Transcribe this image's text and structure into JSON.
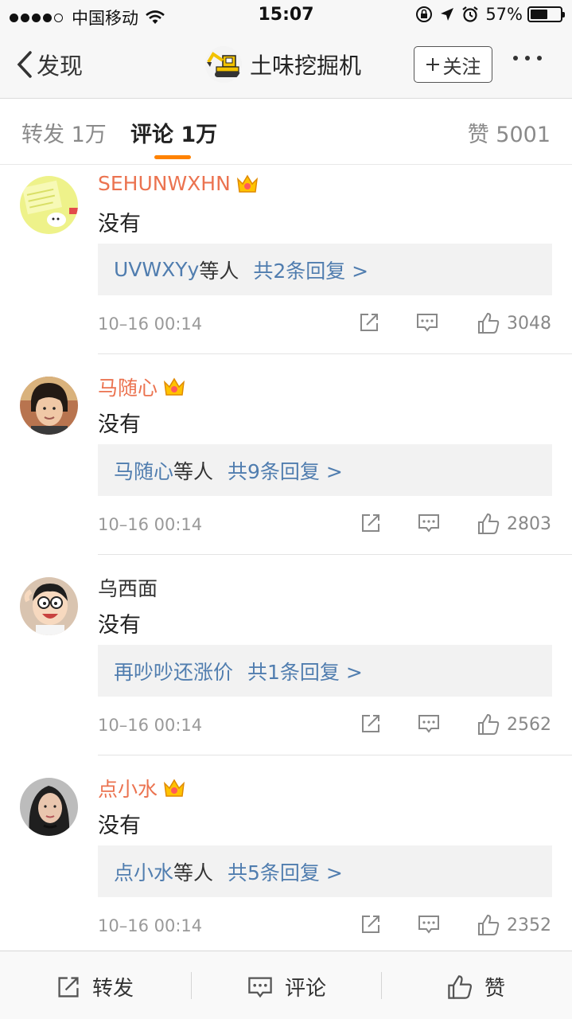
{
  "status_bar": {
    "carrier": "中国移动",
    "time": "15:07",
    "battery_text": "57%",
    "battery_level": 0.57
  },
  "nav": {
    "back_label": "发现",
    "title": "土味挖掘机",
    "follow_label": "关注"
  },
  "tabs": {
    "repost": "转发 1万",
    "comments": "评论 1万",
    "likes": "赞 5001"
  },
  "comments": [
    {
      "name": "SEHUNWXHN",
      "vip": true,
      "text": "没有",
      "reply_users": "UVWXYy",
      "reply_suffix": "等人",
      "reply_count": "共2条回复 >",
      "time": "10–16 00:14",
      "likes": "3048"
    },
    {
      "name": "马随心",
      "vip": true,
      "text": "没有",
      "reply_users": "马随心",
      "reply_suffix": "等人",
      "reply_count": "共9条回复 >",
      "time": "10–16 00:14",
      "likes": "2803"
    },
    {
      "name": "乌西面",
      "vip": false,
      "text": "没有",
      "reply_users": "再吵吵还涨价",
      "reply_suffix": "",
      "reply_count": "共1条回复 >",
      "time": "10–16 00:14",
      "likes": "2562"
    },
    {
      "name": "点小水",
      "vip": true,
      "text": "没有",
      "reply_users": "点小水",
      "reply_suffix": "等人",
      "reply_count": "共5条回复 >",
      "time": "10–16 00:14",
      "likes": "2352"
    }
  ],
  "toolbar": {
    "repost": "转发",
    "comment": "评论",
    "like": "赞"
  },
  "colors": {
    "accent": "#ff8200",
    "vip_name": "#eb7350",
    "link": "#507daf"
  }
}
